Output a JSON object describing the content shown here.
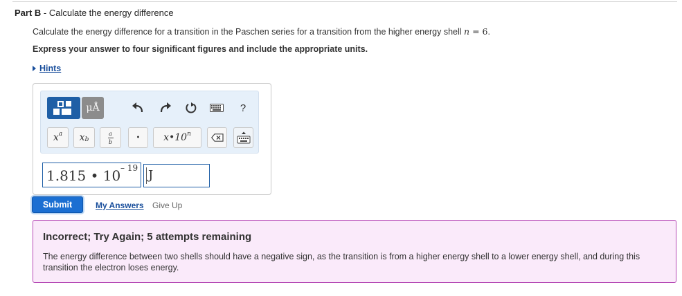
{
  "part": {
    "label": "Part B",
    "separator": " - ",
    "title": "Calculate the energy difference"
  },
  "question": {
    "text": "Calculate the energy difference for a transition in the Paschen series for a transition from the higher energy shell ",
    "variable": "n",
    "equals": " = ",
    "value": "6",
    "period": "."
  },
  "instruction": "Express your answer to four significant figures and include the appropriate units.",
  "hints_label": "Hints",
  "toolbar": {
    "units_label": "μÅ",
    "help_label": "?",
    "keys": {
      "power_base": "x",
      "power_exp": "a",
      "subscript_base": "x",
      "subscript_sub": "b",
      "fraction_num": "a",
      "fraction_den": "b",
      "dot": "•",
      "sci_label": "x•10",
      "sci_exp": "n"
    }
  },
  "answer": {
    "mantissa": "1.815",
    "times": " • ",
    "base": "10",
    "exponent": "– 19",
    "unit": "J"
  },
  "buttons": {
    "submit": "Submit",
    "my_answers": "My Answers",
    "give_up": "Give Up"
  },
  "feedback": {
    "title": "Incorrect; Try Again; 5 attempts remaining",
    "text": "The energy difference between two shells should have a negative sign, as the transition is from a higher energy shell to a lower energy shell, and during this transition the electron loses energy."
  },
  "colors": {
    "primary": "#1b6fd2",
    "link": "#1a4f9c",
    "feedback_bg": "#faeafa",
    "feedback_border": "#b548b5",
    "toolbar_bg": "#e6f0fa"
  }
}
